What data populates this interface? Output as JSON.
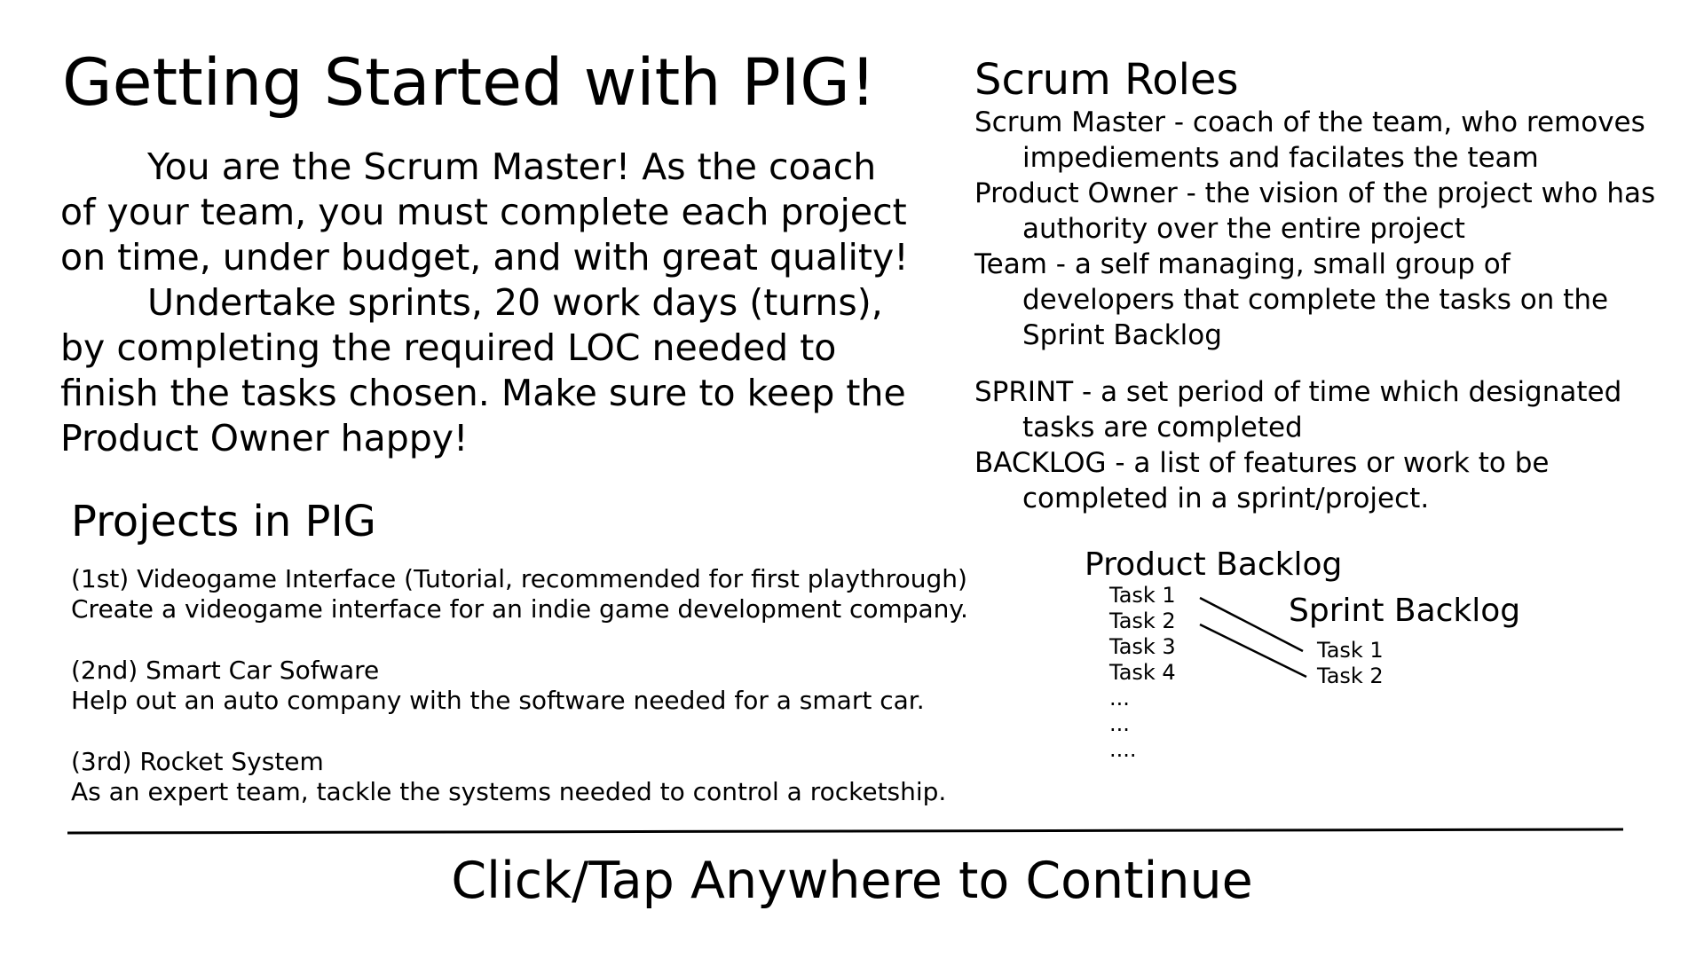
{
  "title": "Getting Started with PIG!",
  "intro": {
    "lines": [
      "You are the Scrum Master! As the coach",
      "of your team, you must complete each project",
      "on time, under budget, and with great quality!",
      "Undertake sprints, 20 work days (turns),",
      "by completing the required LOC needed to",
      "finish the tasks chosen. Make sure to keep the",
      "Product Owner happy!"
    ]
  },
  "scrum_roles": {
    "heading": "Scrum Roles",
    "lines": [
      "Scrum Master - coach of the team, who removes",
      "impediements and facilates the team",
      "Product Owner - the vision of the project who has",
      "authority over the entire project",
      "Team - a self managing, small group of",
      "developers that complete the tasks on the",
      "Sprint Backlog",
      "SPRINT - a set period of time which designated",
      "tasks are completed",
      "BACKLOG - a list of features or work to be",
      "completed in a sprint/project."
    ]
  },
  "projects": {
    "heading": "Projects in PIG",
    "items": [
      {
        "name": "(1st) Videogame Interface (Tutorial, recommended for first playthrough)",
        "description": "Create a videogame interface for an indie game development company."
      },
      {
        "name": "(2nd) Smart Car Sofware",
        "description": "Help out an auto company with the software needed for a smart car."
      },
      {
        "name": "(3rd) Rocket System",
        "description": "As an expert team, tackle the systems needed to control a rocketship."
      }
    ]
  },
  "backlog_diagram": {
    "product_backlog_heading": "Product Backlog",
    "product_backlog_items": [
      "Task 1",
      "Task 2",
      "Task 3",
      "Task 4",
      "...",
      "...",
      "...."
    ],
    "sprint_backlog_heading": "Sprint Backlog",
    "sprint_backlog_items": [
      "Task 1",
      "Task 2"
    ]
  },
  "continue_label": "Click/Tap Anywhere to Continue"
}
